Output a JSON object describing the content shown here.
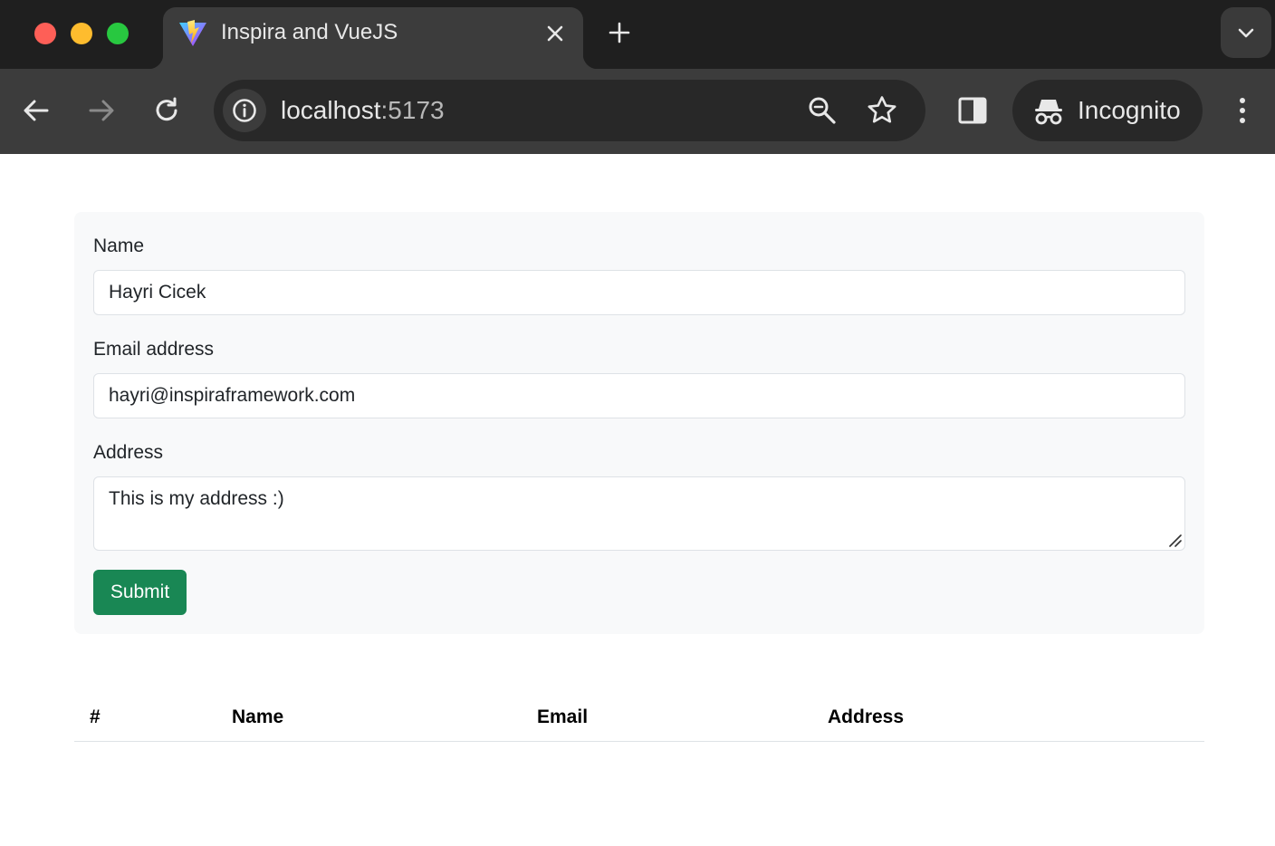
{
  "browser": {
    "tab": {
      "title": "Inspira and VueJS",
      "favicon": "vite-logo-icon"
    },
    "address_bar": {
      "host": "localhost",
      "port": ":5173"
    },
    "profile_label": "Incognito",
    "colors": {
      "tabbar_bg": "#1f1f1f",
      "toolbar_bg": "#3c3c3c",
      "omnibox_bg": "#282828"
    }
  },
  "form": {
    "name_label": "Name",
    "name_value": "Hayri Cicek",
    "email_label": "Email address",
    "email_value": "hayri@inspiraframework.com",
    "address_label": "Address",
    "address_value": "This is my address :)",
    "submit_label": "Submit",
    "colors": {
      "submit_bg": "#198754",
      "card_bg": "#f8f9fa"
    }
  },
  "table": {
    "columns": [
      "#",
      "Name",
      "Email",
      "Address"
    ],
    "rows": []
  }
}
